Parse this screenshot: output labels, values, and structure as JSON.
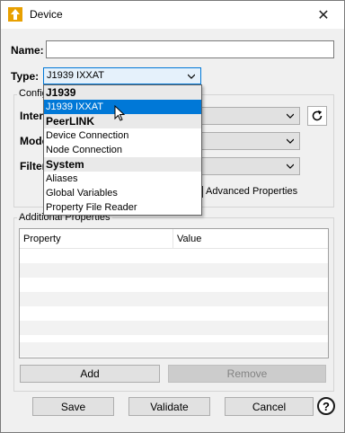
{
  "window": {
    "title": "Device",
    "close_symbol": "✕"
  },
  "form": {
    "name_label": "Name:",
    "name_value": "",
    "type_label": "Type:",
    "type_value": "J1939 IXXAT",
    "config_group_title": "Configuration",
    "interface_label": "Interface:",
    "mode_label": "Mode:",
    "filter_label": "Filter:",
    "advanced_properties_label": "Advanced Properties"
  },
  "type_dropdown": {
    "items": [
      {
        "label": "J1939",
        "kind": "header"
      },
      {
        "label": "J1939 IXXAT",
        "kind": "selected"
      },
      {
        "label": "PeerLINK",
        "kind": "header"
      },
      {
        "label": "Device Connection",
        "kind": "item"
      },
      {
        "label": "Node Connection",
        "kind": "item"
      },
      {
        "label": "System",
        "kind": "header"
      },
      {
        "label": "Aliases",
        "kind": "item"
      },
      {
        "label": "Global Variables",
        "kind": "item"
      },
      {
        "label": "Property File Reader",
        "kind": "item"
      }
    ]
  },
  "additional": {
    "group_title": "Additional Properties",
    "columns": [
      "Property",
      "Value"
    ],
    "add_label": "Add",
    "remove_label": "Remove"
  },
  "footer": {
    "save_label": "Save",
    "validate_label": "Validate",
    "cancel_label": "Cancel",
    "help_symbol": "?"
  }
}
